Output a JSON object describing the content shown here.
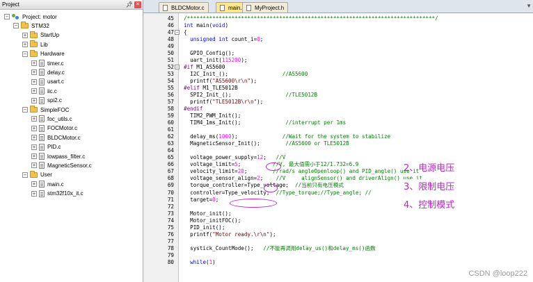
{
  "project_panel": {
    "title": "Project",
    "pin_icon": "pin-icon",
    "close_icon": "close-icon",
    "items": [
      {
        "label": "Project: motor",
        "kind": "project",
        "toggle": "−",
        "depth": 0
      },
      {
        "label": "STM32",
        "kind": "folder",
        "toggle": "−",
        "depth": 1
      },
      {
        "label": "StartUp",
        "kind": "folder",
        "toggle": "+",
        "depth": 2
      },
      {
        "label": "Lib",
        "kind": "folder",
        "toggle": "+",
        "depth": 2
      },
      {
        "label": "Hardware",
        "kind": "folder",
        "toggle": "−",
        "depth": 2
      },
      {
        "label": "timer.c",
        "kind": "file",
        "toggle": "+",
        "depth": 3
      },
      {
        "label": "delay.c",
        "kind": "file",
        "toggle": "+",
        "depth": 3
      },
      {
        "label": "usart.c",
        "kind": "file",
        "toggle": "+",
        "depth": 3
      },
      {
        "label": "iic.c",
        "kind": "file",
        "toggle": "+",
        "depth": 3
      },
      {
        "label": "spi2.c",
        "kind": "file",
        "toggle": "+",
        "depth": 3
      },
      {
        "label": "SimpleFOC",
        "kind": "folder",
        "toggle": "−",
        "depth": 2
      },
      {
        "label": "foc_utils.c",
        "kind": "file",
        "toggle": "+",
        "depth": 3
      },
      {
        "label": "FOCMotor.c",
        "kind": "file",
        "toggle": "+",
        "depth": 3
      },
      {
        "label": "BLDCMotor.c",
        "kind": "file",
        "toggle": "+",
        "depth": 3
      },
      {
        "label": "PID.c",
        "kind": "file",
        "toggle": "+",
        "depth": 3
      },
      {
        "label": "lowpass_filter.c",
        "kind": "file",
        "toggle": "+",
        "depth": 3
      },
      {
        "label": "MagneticSensor.c",
        "kind": "file",
        "toggle": "+",
        "depth": 3
      },
      {
        "label": "User",
        "kind": "folder",
        "toggle": "−",
        "depth": 2
      },
      {
        "label": "main.c",
        "kind": "file",
        "toggle": "+",
        "depth": 3
      },
      {
        "label": "stm32f10x_it.c",
        "kind": "file",
        "toggle": "+",
        "depth": 3
      }
    ]
  },
  "editor": {
    "tabs": [
      {
        "label": "BLDCMotor.c",
        "active": false
      },
      {
        "label": "main.c",
        "active": true
      },
      {
        "label": "MyProject.h",
        "active": false
      }
    ],
    "lines": [
      {
        "n": "45",
        "fold": "",
        "segs": [
          [
            "c-cmt",
            "/******************************************************************************/"
          ]
        ]
      },
      {
        "n": "46",
        "fold": "",
        "segs": [
          [
            "c-kw",
            "int"
          ],
          [
            "c-id",
            " main("
          ],
          [
            "c-kw",
            "void"
          ],
          [
            "c-id",
            ")"
          ]
        ]
      },
      {
        "n": "47",
        "fold": "−",
        "segs": [
          [
            "c-id",
            "{"
          ]
        ]
      },
      {
        "n": "48",
        "fold": "",
        "segs": [
          [
            "c-id",
            "  "
          ],
          [
            "c-kw",
            "unsigned int"
          ],
          [
            "c-id",
            " count_i="
          ],
          [
            "c-num",
            "0"
          ],
          [
            "c-id",
            ";"
          ]
        ]
      },
      {
        "n": "49",
        "fold": "",
        "segs": [
          [
            "c-id",
            ""
          ]
        ]
      },
      {
        "n": "50",
        "fold": "",
        "segs": [
          [
            "c-id",
            "  GPIO_Config();"
          ]
        ]
      },
      {
        "n": "51",
        "fold": "",
        "segs": [
          [
            "c-id",
            "  uart_init("
          ],
          [
            "c-num",
            "115200"
          ],
          [
            "c-id",
            ");"
          ]
        ]
      },
      {
        "n": "52",
        "fold": "−",
        "segs": [
          [
            "c-pp",
            "#if"
          ],
          [
            "c-id",
            " M1_AS5600"
          ]
        ]
      },
      {
        "n": "53",
        "fold": "",
        "segs": [
          [
            "c-id",
            "  I2C_Init_();                 "
          ],
          [
            "c-cmt",
            "//AS5600"
          ]
        ]
      },
      {
        "n": "54",
        "fold": "",
        "segs": [
          [
            "c-id",
            "  printf("
          ],
          [
            "c-str",
            "\"AS5600\\r\\n\""
          ],
          [
            "c-id",
            ");"
          ]
        ]
      },
      {
        "n": "55",
        "fold": "",
        "segs": [
          [
            "c-pp",
            "#elif"
          ],
          [
            "c-id",
            " M1_TLE5012B"
          ]
        ]
      },
      {
        "n": "56",
        "fold": "",
        "segs": [
          [
            "c-id",
            "  SPI2_Init_();                 "
          ],
          [
            "c-cmt",
            "//TLE5012B"
          ]
        ]
      },
      {
        "n": "57",
        "fold": "",
        "segs": [
          [
            "c-id",
            "  printf("
          ],
          [
            "c-str",
            "\"TLE5012B\\r\\n\""
          ],
          [
            "c-id",
            ");"
          ]
        ]
      },
      {
        "n": "58",
        "fold": "",
        "segs": [
          [
            "c-pp",
            "#endif"
          ]
        ]
      },
      {
        "n": "59",
        "fold": "",
        "segs": [
          [
            "c-id",
            "  TIM2_PWM_Init();"
          ]
        ]
      },
      {
        "n": "60",
        "fold": "",
        "segs": [
          [
            "c-id",
            "  TIM4_1ms_Init();              "
          ],
          [
            "c-cmt",
            "//interrupt per 1ms"
          ]
        ]
      },
      {
        "n": "61",
        "fold": "",
        "segs": [
          [
            "c-id",
            ""
          ]
        ]
      },
      {
        "n": "62",
        "fold": "",
        "segs": [
          [
            "c-id",
            "  delay_ms("
          ],
          [
            "c-num",
            "1000"
          ],
          [
            "c-id",
            ");              "
          ],
          [
            "c-cmt",
            "//Wait for the system to stabilize"
          ]
        ]
      },
      {
        "n": "63",
        "fold": "",
        "segs": [
          [
            "c-id",
            "  MagneticSensor_Init();        "
          ],
          [
            "c-cmt",
            "//AS5600 or TLE5012B"
          ]
        ]
      },
      {
        "n": "64",
        "fold": "",
        "segs": [
          [
            "c-id",
            ""
          ]
        ]
      },
      {
        "n": "65",
        "fold": "",
        "segs": [
          [
            "c-id",
            "  voltage_power_supply="
          ],
          [
            "c-num",
            "12"
          ],
          [
            "c-id",
            ";   "
          ],
          [
            "c-cmt",
            "//V"
          ]
        ]
      },
      {
        "n": "66",
        "fold": "",
        "segs": [
          [
            "c-id",
            "  voltage_limit="
          ],
          [
            "c-num",
            "5"
          ],
          [
            "c-id",
            ";          "
          ],
          [
            "c-cmt",
            "//V, 最大值需小于12/1.732=6.9"
          ]
        ]
      },
      {
        "n": "67",
        "fold": "",
        "segs": [
          [
            "c-id",
            "  velocity_limit="
          ],
          [
            "c-num",
            "20"
          ],
          [
            "c-id",
            ";        "
          ],
          [
            "c-cmt",
            "//rad/s angleOpenloop() and PID_angle() use it"
          ]
        ]
      },
      {
        "n": "68",
        "fold": "",
        "segs": [
          [
            "c-id",
            "  voltage_sensor_align="
          ],
          [
            "c-num",
            "2"
          ],
          [
            "c-id",
            ";    "
          ],
          [
            "c-cmt",
            "//V     alignSensor() and driverAlign() use it"
          ]
        ]
      },
      {
        "n": "69",
        "fold": "",
        "segs": [
          [
            "c-id",
            "  torque_controller=Type_voltage;  "
          ],
          [
            "c-cmt",
            "//当前只有电压模式"
          ]
        ]
      },
      {
        "n": "70",
        "fold": "",
        "segs": [
          [
            "c-id",
            "  controller=Type_velocity;  "
          ],
          [
            "c-cmt",
            "//Type_torque;//Type_angle; //"
          ]
        ]
      },
      {
        "n": "71",
        "fold": "",
        "segs": [
          [
            "c-id",
            "  target="
          ],
          [
            "c-num",
            "0"
          ],
          [
            "c-id",
            ";"
          ]
        ]
      },
      {
        "n": "72",
        "fold": "",
        "segs": [
          [
            "c-id",
            ""
          ]
        ]
      },
      {
        "n": "73",
        "fold": "",
        "segs": [
          [
            "c-id",
            "  Motor_init();"
          ]
        ]
      },
      {
        "n": "74",
        "fold": "",
        "segs": [
          [
            "c-id",
            "  Motor_initFOC();"
          ]
        ]
      },
      {
        "n": "75",
        "fold": "",
        "segs": [
          [
            "c-id",
            "  PID_init();"
          ]
        ]
      },
      {
        "n": "76",
        "fold": "",
        "segs": [
          [
            "c-id",
            "  printf("
          ],
          [
            "c-str",
            "\"Motor ready.\\r\\n\""
          ],
          [
            "c-id",
            ");"
          ]
        ]
      },
      {
        "n": "77",
        "fold": "",
        "segs": [
          [
            "c-id",
            ""
          ]
        ]
      },
      {
        "n": "78",
        "fold": "",
        "segs": [
          [
            "c-id",
            "  systick_CountMode();   "
          ],
          [
            "c-cmt",
            "//不能再调用delay_us()和delay_ms()函数"
          ]
        ]
      },
      {
        "n": "79",
        "fold": "",
        "segs": [
          [
            "c-id",
            ""
          ]
        ]
      },
      {
        "n": "80",
        "fold": "",
        "segs": [
          [
            "c-id",
            "  "
          ],
          [
            "c-kw",
            "while"
          ],
          [
            "c-id",
            "("
          ],
          [
            "c-num",
            "1"
          ],
          [
            "c-id",
            ")"
          ]
        ]
      }
    ]
  },
  "annotations": {
    "supply_voltage": "2、电源电压",
    "limit_voltage": "3、限制电压",
    "control_mode": "4、控制模式",
    "color": "#c020d0"
  },
  "watermark": "CSDN @loop222"
}
